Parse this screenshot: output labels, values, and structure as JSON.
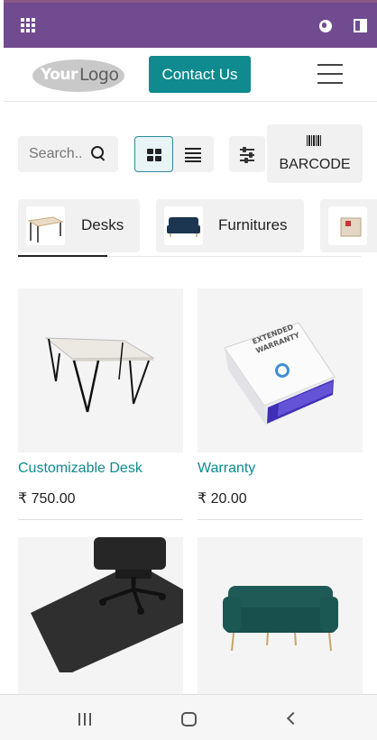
{
  "topbar": {
    "apps_icon": "grid-apps-icon",
    "globe_icon": "globe-icon",
    "panel_icon": "sidebar-panel-icon",
    "color": "#714b8f"
  },
  "header": {
    "logo_text_1": "Your",
    "logo_text_2": "Logo",
    "contact_label": "Contact Us",
    "menu_icon": "hamburger-menu-icon",
    "accent": "#0f8a8e"
  },
  "toolbar": {
    "search_placeholder": "Search...",
    "search_icon": "magnifier-icon",
    "grid_view_icon": "grid-view-icon",
    "list_view_icon": "list-view-icon",
    "filter_icon": "sliders-icon",
    "barcode_icon": "barcode-icon",
    "barcode_label": "BARCODE"
  },
  "categories": [
    {
      "name": "Desks",
      "active": true
    },
    {
      "name": "Furnitures",
      "active": false
    },
    {
      "name": "",
      "active": false
    }
  ],
  "products": [
    {
      "name": "Customizable Desk",
      "price": "₹ 750.00"
    },
    {
      "name": "Warranty",
      "price": "₹ 20.00"
    },
    {
      "name": "",
      "price": ""
    },
    {
      "name": "",
      "price": ""
    }
  ],
  "product_images": {
    "warranty_box_line1": "EXTENDED",
    "warranty_box_line2": "WARRANTY"
  },
  "android_nav": {
    "recent_icon": "recent-apps-icon",
    "home_icon": "home-icon",
    "back_icon": "back-icon"
  }
}
